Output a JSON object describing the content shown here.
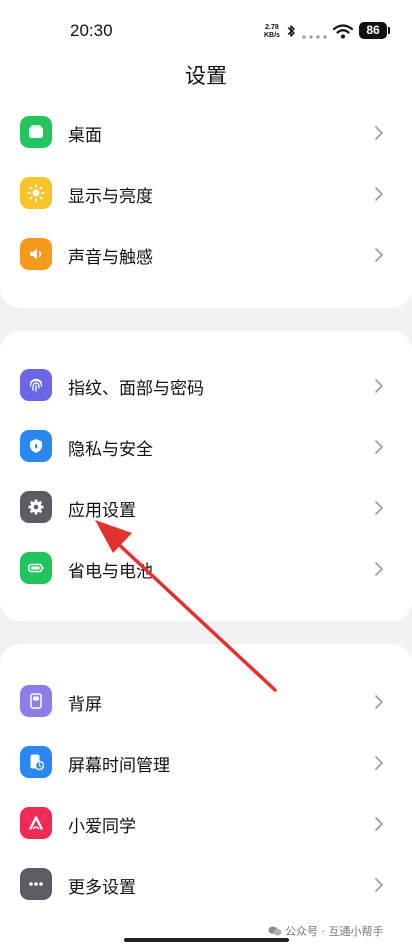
{
  "status_bar": {
    "time": "20:30",
    "net_speed_value": "2.78",
    "net_speed_unit": "KB/s",
    "battery": "86"
  },
  "header": {
    "title": "设置"
  },
  "groups": [
    [
      {
        "label": "桌面",
        "icon": "desktop-icon",
        "color": "#22c55e"
      },
      {
        "label": "显示与亮度",
        "icon": "sun-icon",
        "color": "#f7c52b"
      },
      {
        "label": "声音与触感",
        "icon": "speaker-icon",
        "color": "#f59a1d"
      }
    ],
    [
      {
        "label": "指纹、面部与密码",
        "icon": "fingerprint-icon",
        "color": "#6b66e6"
      },
      {
        "label": "隐私与安全",
        "icon": "shield-icon",
        "color": "#2a86f0"
      },
      {
        "label": "应用设置",
        "icon": "gear-icon",
        "color": "#5b5d63"
      },
      {
        "label": "省电与电池",
        "icon": "battery-icon",
        "color": "#21c45d"
      }
    ],
    [
      {
        "label": "背屏",
        "icon": "back-screen-icon",
        "color": "#8b7ee8"
      },
      {
        "label": "屏幕时间管理",
        "icon": "screen-time-icon",
        "color": "#2a86f0"
      },
      {
        "label": "小爱同学",
        "icon": "xiaoai-icon",
        "color": "#ee2b54"
      },
      {
        "label": "更多设置",
        "icon": "more-icon",
        "color": "#5b5d63"
      }
    ]
  ],
  "colors": {
    "annotation_arrow": "#e2322f",
    "page_background": "#f2f2f4"
  },
  "watermark": {
    "text": "公众号 · 互通小帮手"
  }
}
